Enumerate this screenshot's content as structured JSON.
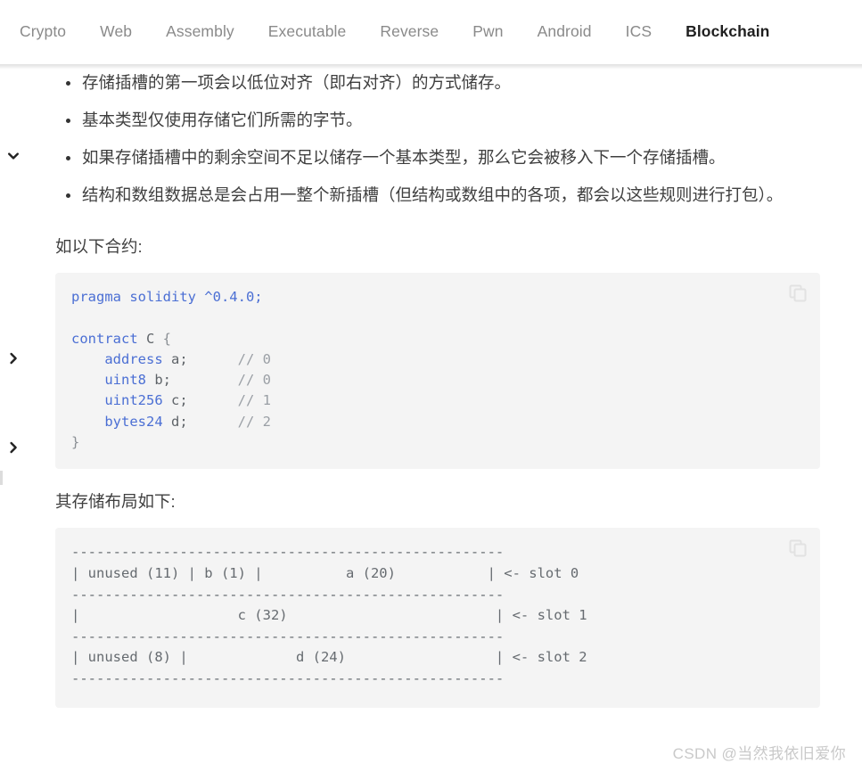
{
  "nav": {
    "items": [
      {
        "label": "Crypto",
        "active": false
      },
      {
        "label": "Web",
        "active": false
      },
      {
        "label": "Assembly",
        "active": false
      },
      {
        "label": "Executable",
        "active": false
      },
      {
        "label": "Reverse",
        "active": false
      },
      {
        "label": "Pwn",
        "active": false
      },
      {
        "label": "Android",
        "active": false
      },
      {
        "label": "ICS",
        "active": false
      },
      {
        "label": "Blockchain",
        "active": true
      }
    ]
  },
  "rail": {
    "chevron_down": "chevron-down-icon",
    "chevron_right_1": "chevron-right-icon",
    "chevron_right_2": "chevron-right-icon"
  },
  "article": {
    "rules": [
      "存储插槽的第一项会以低位对齐（即右对齐）的方式储存。",
      "基本类型仅使用存储它们所需的字节。",
      "如果存储插槽中的剩余空间不足以储存一个基本类型，那么它会被移入下一个存储插槽。",
      "结构和数组数据总是会占用一整个新插槽（但结构或数组中的各项，都会以这些规则进行打包）。"
    ],
    "contract_intro": "如以下合约:",
    "layout_intro": "其存储布局如下:"
  },
  "code_solidity": {
    "copy_label": "copy-icon",
    "lines": [
      [
        {
          "t": "pragma solidity ^0.4.0;",
          "c": "kw"
        }
      ],
      [
        {
          "t": "",
          "c": "plain"
        }
      ],
      [
        {
          "t": "contract",
          "c": "kw"
        },
        {
          "t": " C ",
          "c": "plain"
        },
        {
          "t": "{",
          "c": "punc"
        }
      ],
      [
        {
          "t": "    ",
          "c": "plain"
        },
        {
          "t": "address",
          "c": "kw"
        },
        {
          "t": " a;      ",
          "c": "plain"
        },
        {
          "t": "// 0",
          "c": "cmt"
        }
      ],
      [
        {
          "t": "    ",
          "c": "plain"
        },
        {
          "t": "uint8",
          "c": "kw"
        },
        {
          "t": " b;        ",
          "c": "plain"
        },
        {
          "t": "// 0",
          "c": "cmt"
        }
      ],
      [
        {
          "t": "    ",
          "c": "plain"
        },
        {
          "t": "uint256",
          "c": "kw"
        },
        {
          "t": " c;      ",
          "c": "plain"
        },
        {
          "t": "// 1",
          "c": "cmt"
        }
      ],
      [
        {
          "t": "    ",
          "c": "plain"
        },
        {
          "t": "bytes24",
          "c": "kw"
        },
        {
          "t": " d;      ",
          "c": "plain"
        },
        {
          "t": "// 2",
          "c": "cmt"
        }
      ],
      [
        {
          "t": "}",
          "c": "punc"
        }
      ]
    ]
  },
  "code_layout": {
    "copy_label": "copy-icon",
    "text": "----------------------------------------------------\n| unused (11) | b (1) |          a (20)           | <- slot 0\n----------------------------------------------------\n|                   c (32)                         | <- slot 1\n----------------------------------------------------\n| unused (8) |             d (24)                  | <- slot 2\n----------------------------------------------------"
  },
  "watermark": {
    "text": "CSDN @当然我依旧爱你"
  },
  "colors": {
    "keyword": "#4b6fd4",
    "comment": "#9a9fa5",
    "code_bg": "#f4f4f4",
    "nav_inactive": "#8a8a8a",
    "nav_active": "#1f1f1f",
    "watermark": "#c9c9c9"
  }
}
